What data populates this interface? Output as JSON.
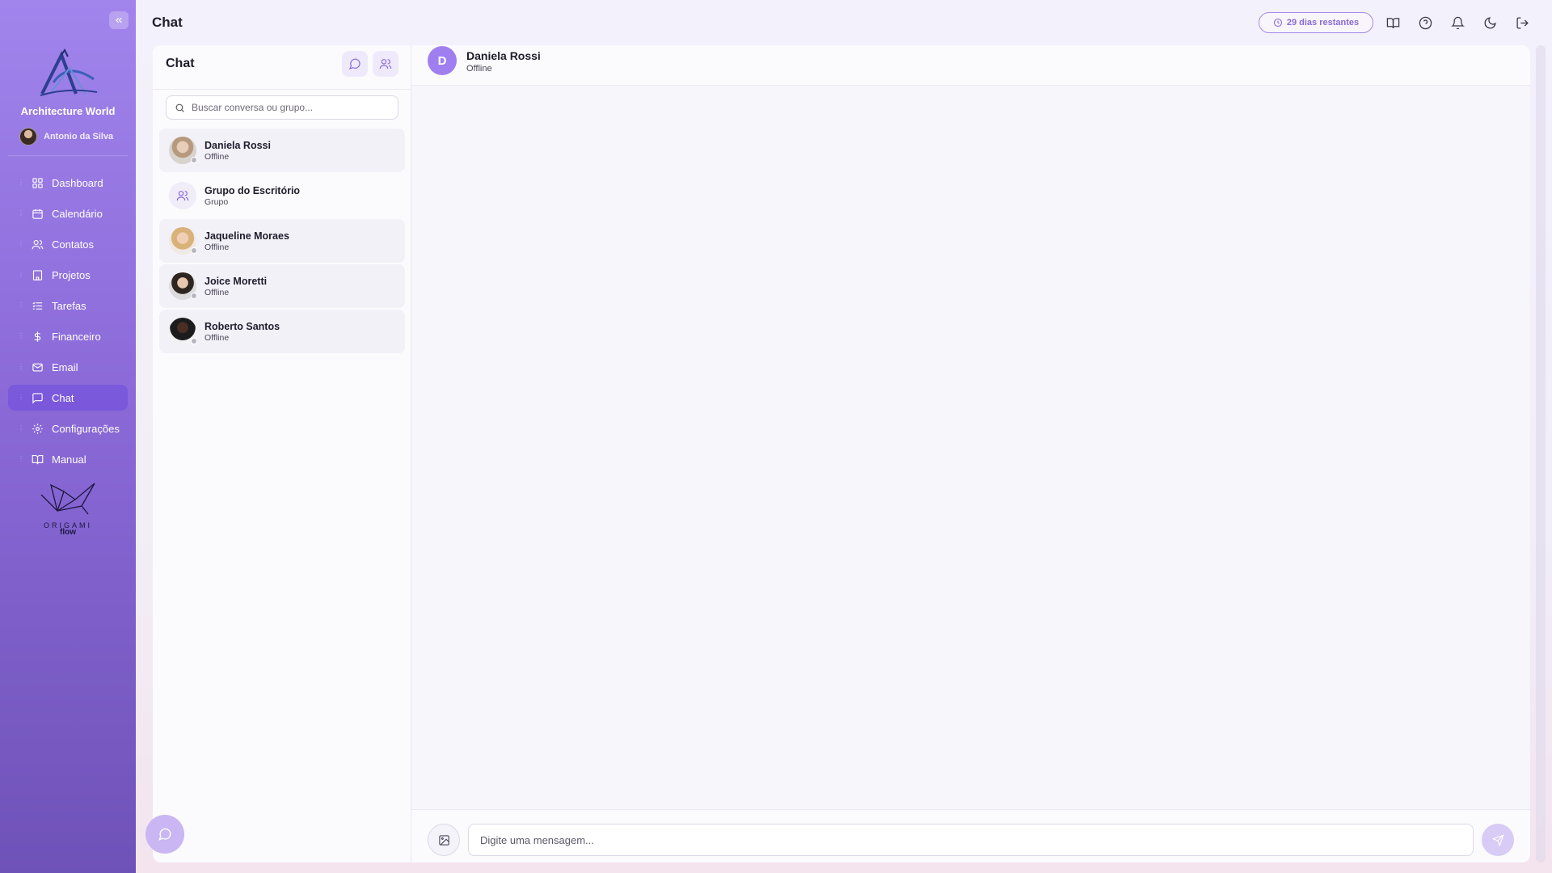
{
  "sidebar": {
    "org_name": "Architecture World",
    "user_name": "Antonio da Silva",
    "items": [
      {
        "label": "Dashboard",
        "icon": "grid-icon"
      },
      {
        "label": "Calendário",
        "icon": "calendar-icon"
      },
      {
        "label": "Contatos",
        "icon": "users-icon"
      },
      {
        "label": "Projetos",
        "icon": "building-icon"
      },
      {
        "label": "Tarefas",
        "icon": "list-icon"
      },
      {
        "label": "Financeiro",
        "icon": "dollar-icon"
      },
      {
        "label": "Email",
        "icon": "mail-icon"
      },
      {
        "label": "Chat",
        "icon": "message-icon",
        "active": true
      },
      {
        "label": "Configurações",
        "icon": "gear-icon"
      },
      {
        "label": "Manual",
        "icon": "book-icon"
      }
    ],
    "footer_logo": {
      "word": "ORIGAMI",
      "sub": "flow"
    }
  },
  "header": {
    "title": "Chat",
    "trial_badge": "29 dias restantes",
    "icons": [
      "book-open-icon",
      "help-icon",
      "bell-icon",
      "moon-icon",
      "logout-icon"
    ]
  },
  "conversations": {
    "title": "Chat",
    "search_placeholder": "Buscar conversa ou grupo...",
    "items": [
      {
        "name": "Daniela Rossi",
        "status": "Offline"
      },
      {
        "name": "Grupo do Escritório",
        "status": "Grupo"
      },
      {
        "name": "Jaqueline Moraes",
        "status": "Offline"
      },
      {
        "name": "Joice Moretti",
        "status": "Offline"
      },
      {
        "name": "Roberto Santos",
        "status": "Offline"
      }
    ]
  },
  "chat": {
    "contact_initial": "D",
    "contact_name": "Daniela Rossi",
    "contact_status": "Offline",
    "input_placeholder": "Digite uma mensagem..."
  },
  "colors": {
    "accent": "#9f7ff0",
    "sidebar_top": "#a184ec",
    "sidebar_bottom": "#6f52b8",
    "active_nav": "#7856dc"
  }
}
